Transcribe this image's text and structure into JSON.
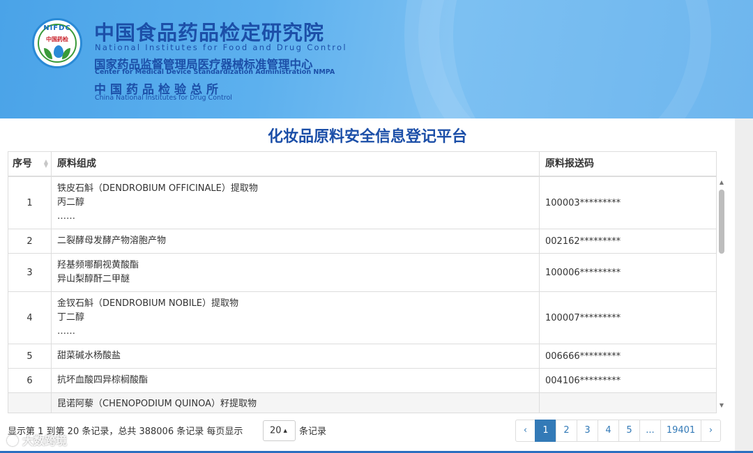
{
  "header": {
    "logo_text": "NIFDC",
    "logo_sub": "中国药检",
    "title_cn": "中国食品药品检定研究院",
    "title_en": "National Institutes for Food and Drug Control",
    "sub1_cn": "国家药品监督管理局医疗器械标准管理中心",
    "sub1_en": "Center for Medical Device Standardization Administration NMPA",
    "sub2_cn": "中国药品检验总所",
    "sub2_en": "China National Institutes for Drug Control"
  },
  "page_title": "化妆品原料安全信息登记平台",
  "table": {
    "columns": [
      "序号",
      "原料组成",
      "原料报送码"
    ],
    "rows": [
      {
        "seq": "1",
        "lines": [
          "铁皮石斛（DENDROBIUM OFFICINALE）提取物",
          "丙二醇",
          "……"
        ],
        "code": "100003*********"
      },
      {
        "seq": "2",
        "lines": [
          "二裂酵母发酵产物溶胞产物"
        ],
        "code": "002162*********"
      },
      {
        "seq": "3",
        "lines": [
          "羟基频哪酮视黄酸酯",
          "异山梨醇酐二甲醚"
        ],
        "code": "100006*********"
      },
      {
        "seq": "4",
        "lines": [
          "金钗石斛（DENDROBIUM NOBILE）提取物",
          "丁二醇",
          "……"
        ],
        "code": "100007*********"
      },
      {
        "seq": "5",
        "lines": [
          "甜菜碱水杨酸盐"
        ],
        "code": "006666*********"
      },
      {
        "seq": "6",
        "lines": [
          "抗坏血酸四异棕榈酸酯"
        ],
        "code": "004106*********"
      },
      {
        "seq": "",
        "lines": [
          "昆诺阿藜（CHENOPODIUM QUINOA）籽提取物"
        ],
        "code": ""
      }
    ]
  },
  "footer": {
    "info": "显示第 1 到第 20 条记录，总共 388006 条记录  每页显示",
    "page_size": "20",
    "info_suffix": "条记录",
    "pages": [
      "‹",
      "1",
      "2",
      "3",
      "4",
      "5",
      "...",
      "19401",
      "›"
    ],
    "active_page": "1"
  },
  "watermark": "大数跨境",
  "colors": {
    "brand": "#1c4fa8",
    "accent": "#337ab7",
    "border": "#dddddd"
  }
}
